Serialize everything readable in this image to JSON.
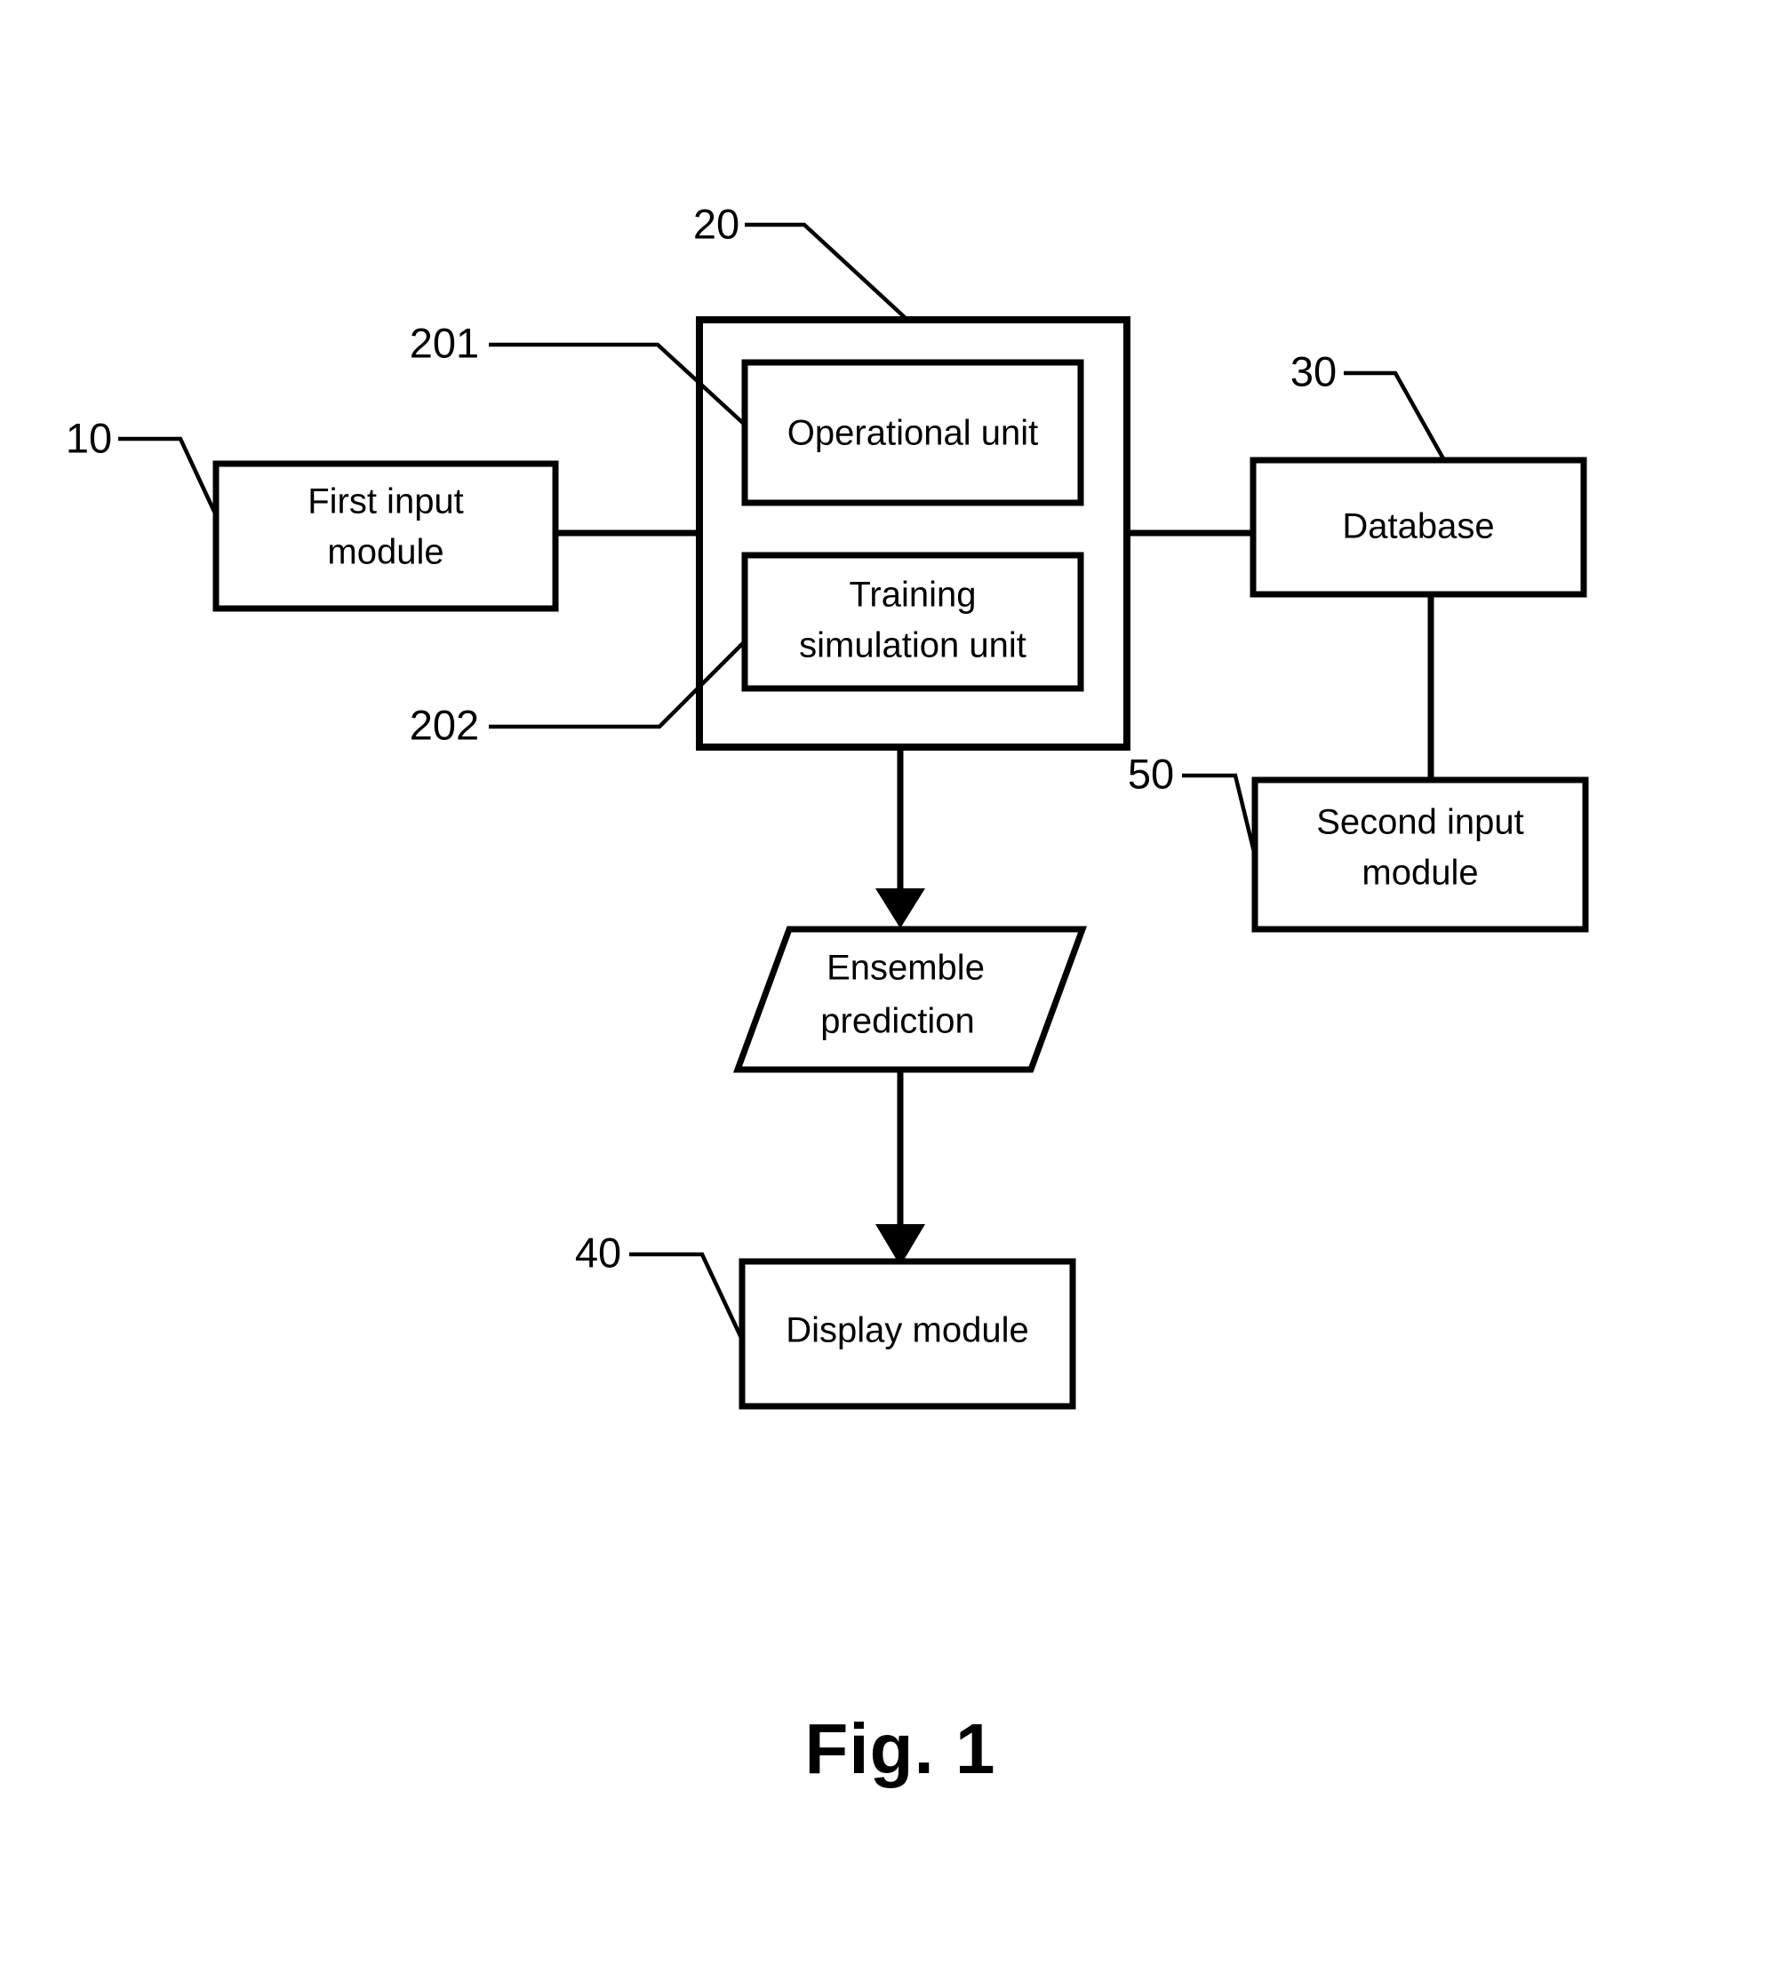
{
  "figure": {
    "caption": "Fig. 1",
    "type": "block-diagram"
  },
  "nodes": {
    "first_input_module": {
      "label_line1": "First input",
      "label_line2": "module",
      "ref": "10",
      "shape": "rectangle"
    },
    "system_container": {
      "ref": "20",
      "shape": "rectangle"
    },
    "operational_unit": {
      "label_line1": "Operational unit",
      "ref": "201",
      "shape": "rectangle"
    },
    "training_simulation_unit": {
      "label_line1": "Training",
      "label_line2": "simulation unit",
      "ref": "202",
      "shape": "rectangle"
    },
    "database": {
      "label_line1": "Database",
      "ref": "30",
      "shape": "rectangle"
    },
    "second_input_module": {
      "label_line1": "Second input",
      "label_line2": "module",
      "ref": "50",
      "shape": "rectangle"
    },
    "ensemble_prediction": {
      "label_line1": "Ensemble",
      "label_line2": "prediction",
      "shape": "parallelogram"
    },
    "display_module": {
      "label_line1": "Display module",
      "ref": "40",
      "shape": "rectangle"
    }
  },
  "connections": [
    {
      "name": "first-input-to-system",
      "from": "first_input_module",
      "to": "system_container",
      "arrow": false
    },
    {
      "name": "system-to-database",
      "from": "system_container",
      "to": "database",
      "arrow": false
    },
    {
      "name": "database-to-second-input",
      "from": "database",
      "to": "second_input_module",
      "arrow": false
    },
    {
      "name": "system-to-ensemble",
      "from": "system_container",
      "to": "ensemble_prediction",
      "arrow": true
    },
    {
      "name": "ensemble-to-display",
      "from": "ensemble_prediction",
      "to": "display_module",
      "arrow": true
    }
  ],
  "colors": {
    "stroke": "#000000",
    "fill": "#ffffff",
    "background": "#ffffff"
  }
}
